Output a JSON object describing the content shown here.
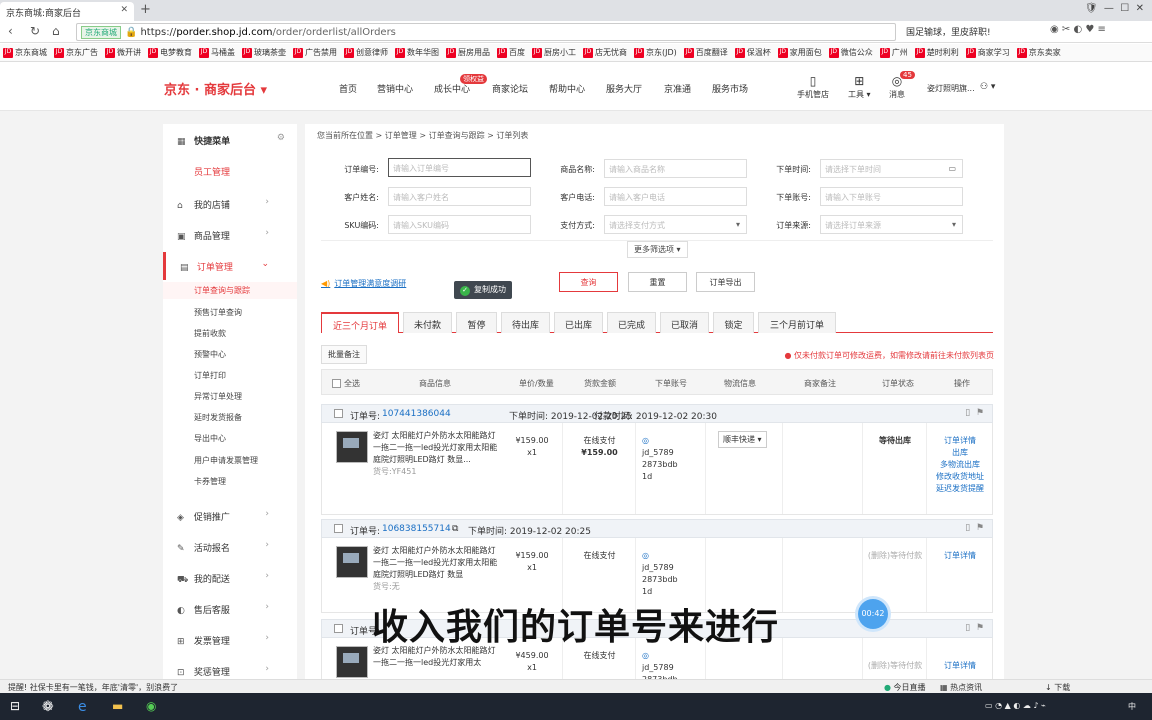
{
  "browser": {
    "tab_title": "京东商城:商家后台",
    "url_badge": "京东商城",
    "url_prefix": "https://",
    "url_host": "porder.shop.jd.com",
    "url_path": "/order/orderlist/allOrders",
    "promo_text": "国足输球，里皮辞职!"
  },
  "bookmarks": [
    "京东商城",
    "京东广告",
    "微开讲",
    "电梦教育",
    "马桶盖",
    "玻璃茶壶",
    "广告禁用",
    "创意律师",
    "数年华图",
    "厨房用品",
    "百度",
    "厨房小工",
    "店无忧商",
    "京东(JD)",
    "百度翻译",
    "保温杯",
    "家用面包",
    "微信公众",
    "广州",
    "楚时利利",
    "商家学习",
    "京东卖家"
  ],
  "topnav": {
    "logo": "京东 · 商家后台",
    "items": [
      "首页",
      "营销中心",
      "成长中心",
      "商家论坛",
      "帮助中心",
      "服务大厅",
      "京准通",
      "服务市场"
    ],
    "hot_badge": "领权益",
    "right": [
      "手机管店",
      "工具",
      "消息"
    ],
    "msg_count": "45",
    "shop_name": "姿灯照明旗..."
  },
  "sidebar": {
    "quick_menu": "快捷菜单",
    "staff": "员工管理",
    "items": [
      "我的店铺",
      "商品管理",
      "订单管理",
      "促销推广",
      "活动报名",
      "我的配送",
      "售后客服",
      "发票管理",
      "奖惩管理"
    ],
    "order_sub": [
      "订单查询与跟踪",
      "预售订单查询",
      "提前收款",
      "预警中心",
      "订单打印",
      "异常订单处理",
      "延时发货报备",
      "导出中心",
      "用户申请发票管理",
      "卡券管理"
    ]
  },
  "breadcrumb": "您当前所在位置 > 订单管理 > 订单查询与跟踪 > 订单列表",
  "filters": {
    "labels": [
      "订单编号:",
      "商品名称:",
      "下单时间:",
      "客户姓名:",
      "客户电话:",
      "下单账号:",
      "SKU编码:",
      "支付方式:",
      "订单来源:"
    ],
    "placeholders": [
      "请输入订单编号",
      "请输入商品名称",
      "请选择下单时间",
      "请输入客户姓名",
      "请输入客户电话",
      "请输入下单账号",
      "请输入SKU编码",
      "请选择支付方式",
      "请选择订单来源"
    ],
    "more": "更多筛选项 ▾"
  },
  "notice": "订单管理满意度调研",
  "actions": [
    "查询",
    "重置",
    "订单导出"
  ],
  "status_tabs": [
    "近三个月订单",
    "未付款",
    "暂停",
    "待出库",
    "已出库",
    "已完成",
    "已取消",
    "锁定",
    "三个月前订单"
  ],
  "batch": "批量备注",
  "tip": "仅未付款订单可修改运费，如需修改请前往未付款列表页",
  "columns": [
    "全选",
    "商品信息",
    "单价/数量",
    "货款金额",
    "下单账号",
    "物流信息",
    "商家备注",
    "订单状态",
    "操作"
  ],
  "orders": [
    {
      "no_label": "订单号:",
      "no": "107441386044",
      "time": "下单时间: 2019-12-02 20:25",
      "paytime": "付款时间: 2019-12-02 20:30",
      "product": "姿灯 太阳能灯户外防水太阳能路灯一拖二一拖一led投光灯家用太阳能庭院灯照明LED路灯 数显...",
      "sku": "货号:YF451",
      "price": "¥159.00",
      "qty": "x1",
      "pay_method": "在线支付",
      "amount": "¥159.00",
      "account": "jd_5789 2873bdb 1d",
      "ship": "顺丰快递 ▾",
      "state": "等待出库",
      "ops": [
        "订单详情",
        "出库",
        "多物流出库",
        "修改收货地址",
        "延迟发货提醒"
      ]
    },
    {
      "no_label": "订单号:",
      "no": "106838155714",
      "time": "下单时间: 2019-12-02 20:25",
      "product": "姿灯 太阳能灯户外防水太阳能路灯一拖二一拖一led投光灯家用太阳能庭院灯照明LED路灯 数显",
      "sku": "货号:无",
      "price": "¥159.00",
      "qty": "x1",
      "pay_method": "在线支付",
      "account": "jd_5789 2873bdb 1d",
      "state": "(删除)等待付款",
      "ops": [
        "订单详情"
      ]
    },
    {
      "no_label": "订单号:",
      "product": "姿灯 太阳能灯户外防水太阳能路灯一拖二一拖一led投光灯家用太",
      "price": "¥459.00",
      "qty": "x1",
      "pay_method": "在线支付",
      "account": "jd_5789 2873bdb",
      "state": "(删除)等待付款",
      "ops": [
        "订单详情"
      ]
    }
  ],
  "toast": "复制成功",
  "subtitle": "收入我们的订单号来进行",
  "timer": "00:42",
  "statusbar": {
    "left": "提醒! 社保卡里有一笔钱，年底'清零'，别浪费了",
    "right": [
      "今日直播",
      "热点资讯",
      "下载"
    ]
  },
  "taskbar": {
    "ime": "中"
  }
}
